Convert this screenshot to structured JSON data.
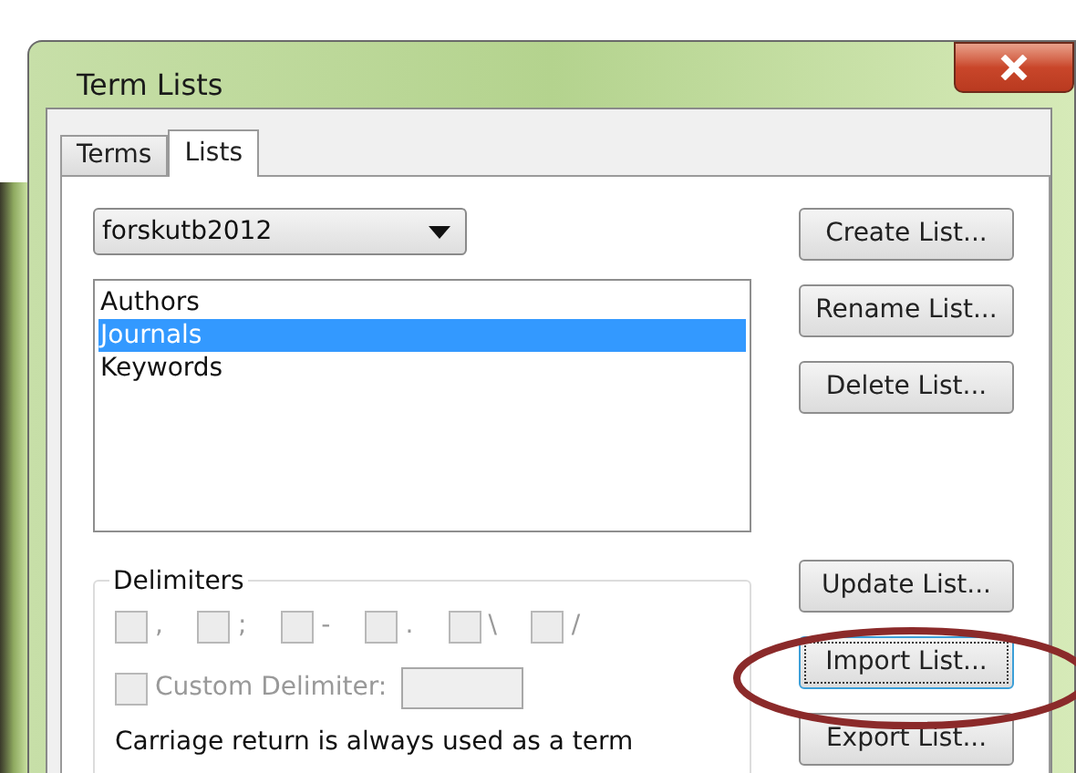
{
  "window": {
    "title": "Term Lists"
  },
  "tabs": [
    {
      "label": "Terms",
      "selected": false
    },
    {
      "label": "Lists",
      "selected": true
    }
  ],
  "list_dropdown": {
    "value": "forskutb2012"
  },
  "lists": [
    {
      "label": "Authors",
      "selected": false
    },
    {
      "label": "Journals",
      "selected": true
    },
    {
      "label": "Keywords",
      "selected": false
    }
  ],
  "delimiters": {
    "title": "Delimiters",
    "options": [
      {
        "label": ",",
        "checked": false
      },
      {
        "label": ";",
        "checked": false
      },
      {
        "label": "-",
        "checked": false
      },
      {
        "label": ".",
        "checked": false
      },
      {
        "label": "\\",
        "checked": false
      },
      {
        "label": "/",
        "checked": false
      }
    ],
    "custom": {
      "label": "Custom Delimiter:",
      "checked": false
    },
    "note": "Carriage return is always used as a term"
  },
  "buttons": [
    {
      "label": "Create List...",
      "focused": false
    },
    {
      "label": "Rename List...",
      "focused": false
    },
    {
      "label": "Delete List...",
      "focused": false
    },
    {
      "label": "Update List...",
      "focused": false
    },
    {
      "label": "Import List...",
      "focused": true
    },
    {
      "label": "Export List...",
      "focused": false
    }
  ]
}
